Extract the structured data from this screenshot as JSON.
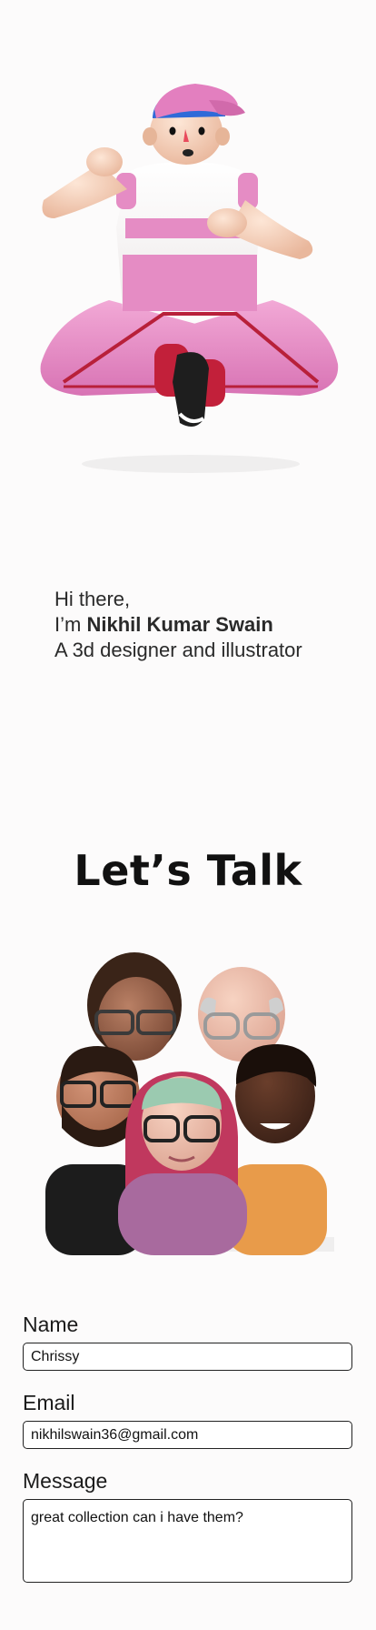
{
  "intro": {
    "greeting": "Hi there,",
    "im_prefix": "I’m ",
    "name": "Nikhil Kumar Swain",
    "tagline": "A 3d designer and illustrator"
  },
  "contact": {
    "title": "Let’s Talk",
    "name_label": "Name",
    "name_value": "Chrissy",
    "email_label": "Email",
    "email_value": "nikhilswain36@gmail.com",
    "message_label": "Message",
    "message_value": "great collection can i have them?"
  },
  "colors": {
    "background": "#fcfbfb",
    "accent_pink": "#e58cc4",
    "accent_red": "#c2203a"
  }
}
